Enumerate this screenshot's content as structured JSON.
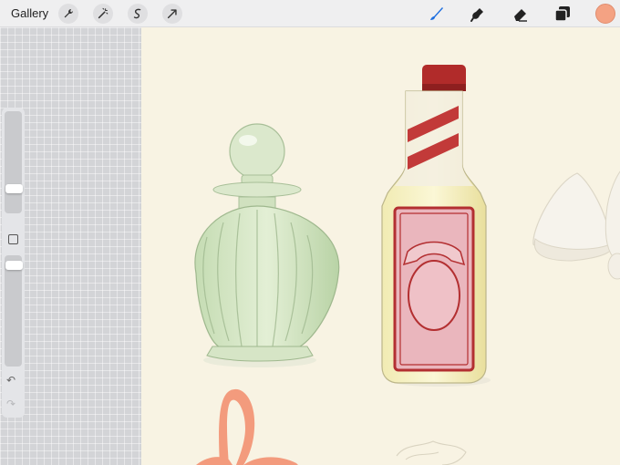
{
  "topbar": {
    "gallery_label": "Gallery",
    "left_tools": [
      "wrench-icon",
      "magic-wand-icon",
      "selection-icon",
      "transform-icon"
    ],
    "right_tools": [
      "brush-icon",
      "smudge-icon",
      "eraser-icon",
      "layers-icon"
    ],
    "active_tool": "brush-icon",
    "current_color": "#f4a283",
    "accent_color": "#1e6fe0"
  },
  "sidebar": {
    "brush_size_slider": 0.22,
    "opacity_slider": 0.95,
    "undo_icon": "undo-icon",
    "redo_icon": "redo-icon"
  },
  "canvas": {
    "background_color": "#f8f3e3",
    "subjects": [
      "green-perfume-bottle",
      "red-label-bottle",
      "white-meringues",
      "orange-ribbon"
    ]
  }
}
